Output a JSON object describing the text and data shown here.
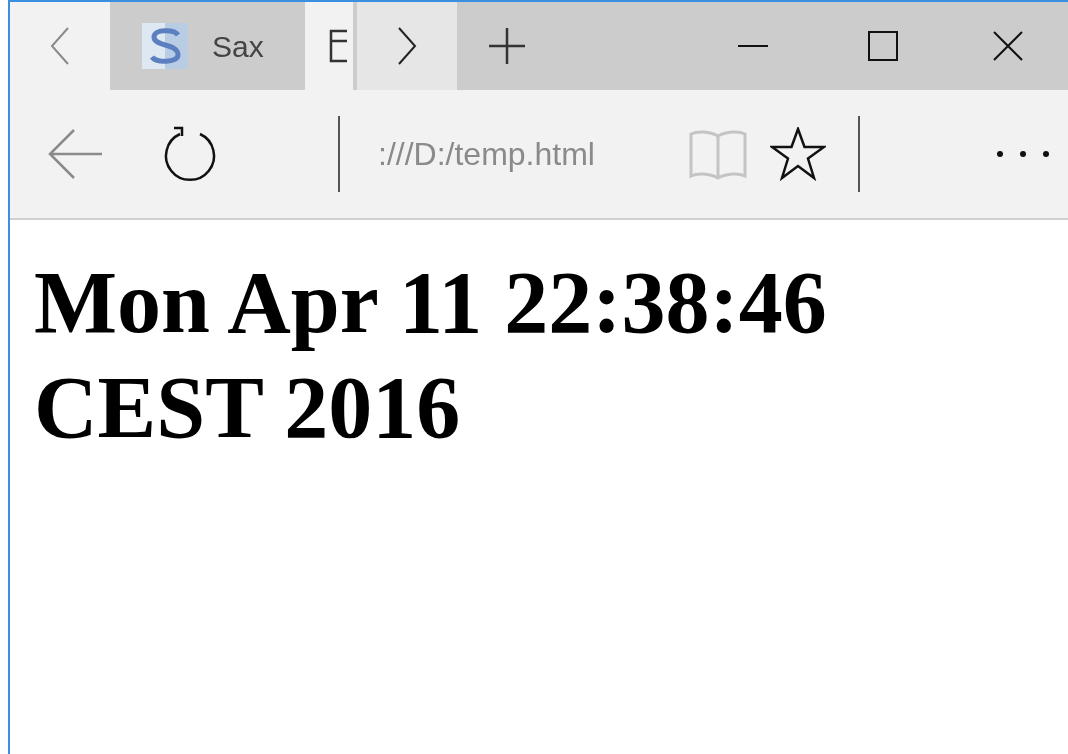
{
  "tabs": [
    {
      "title": "Sax",
      "selected": false,
      "kind": "site"
    },
    {
      "selected": true,
      "kind": "page"
    }
  ],
  "address_bar": {
    "url": ":///D:/temp.html"
  },
  "page": {
    "heading": "Mon Apr 11 22:38:46 CEST 2016"
  }
}
